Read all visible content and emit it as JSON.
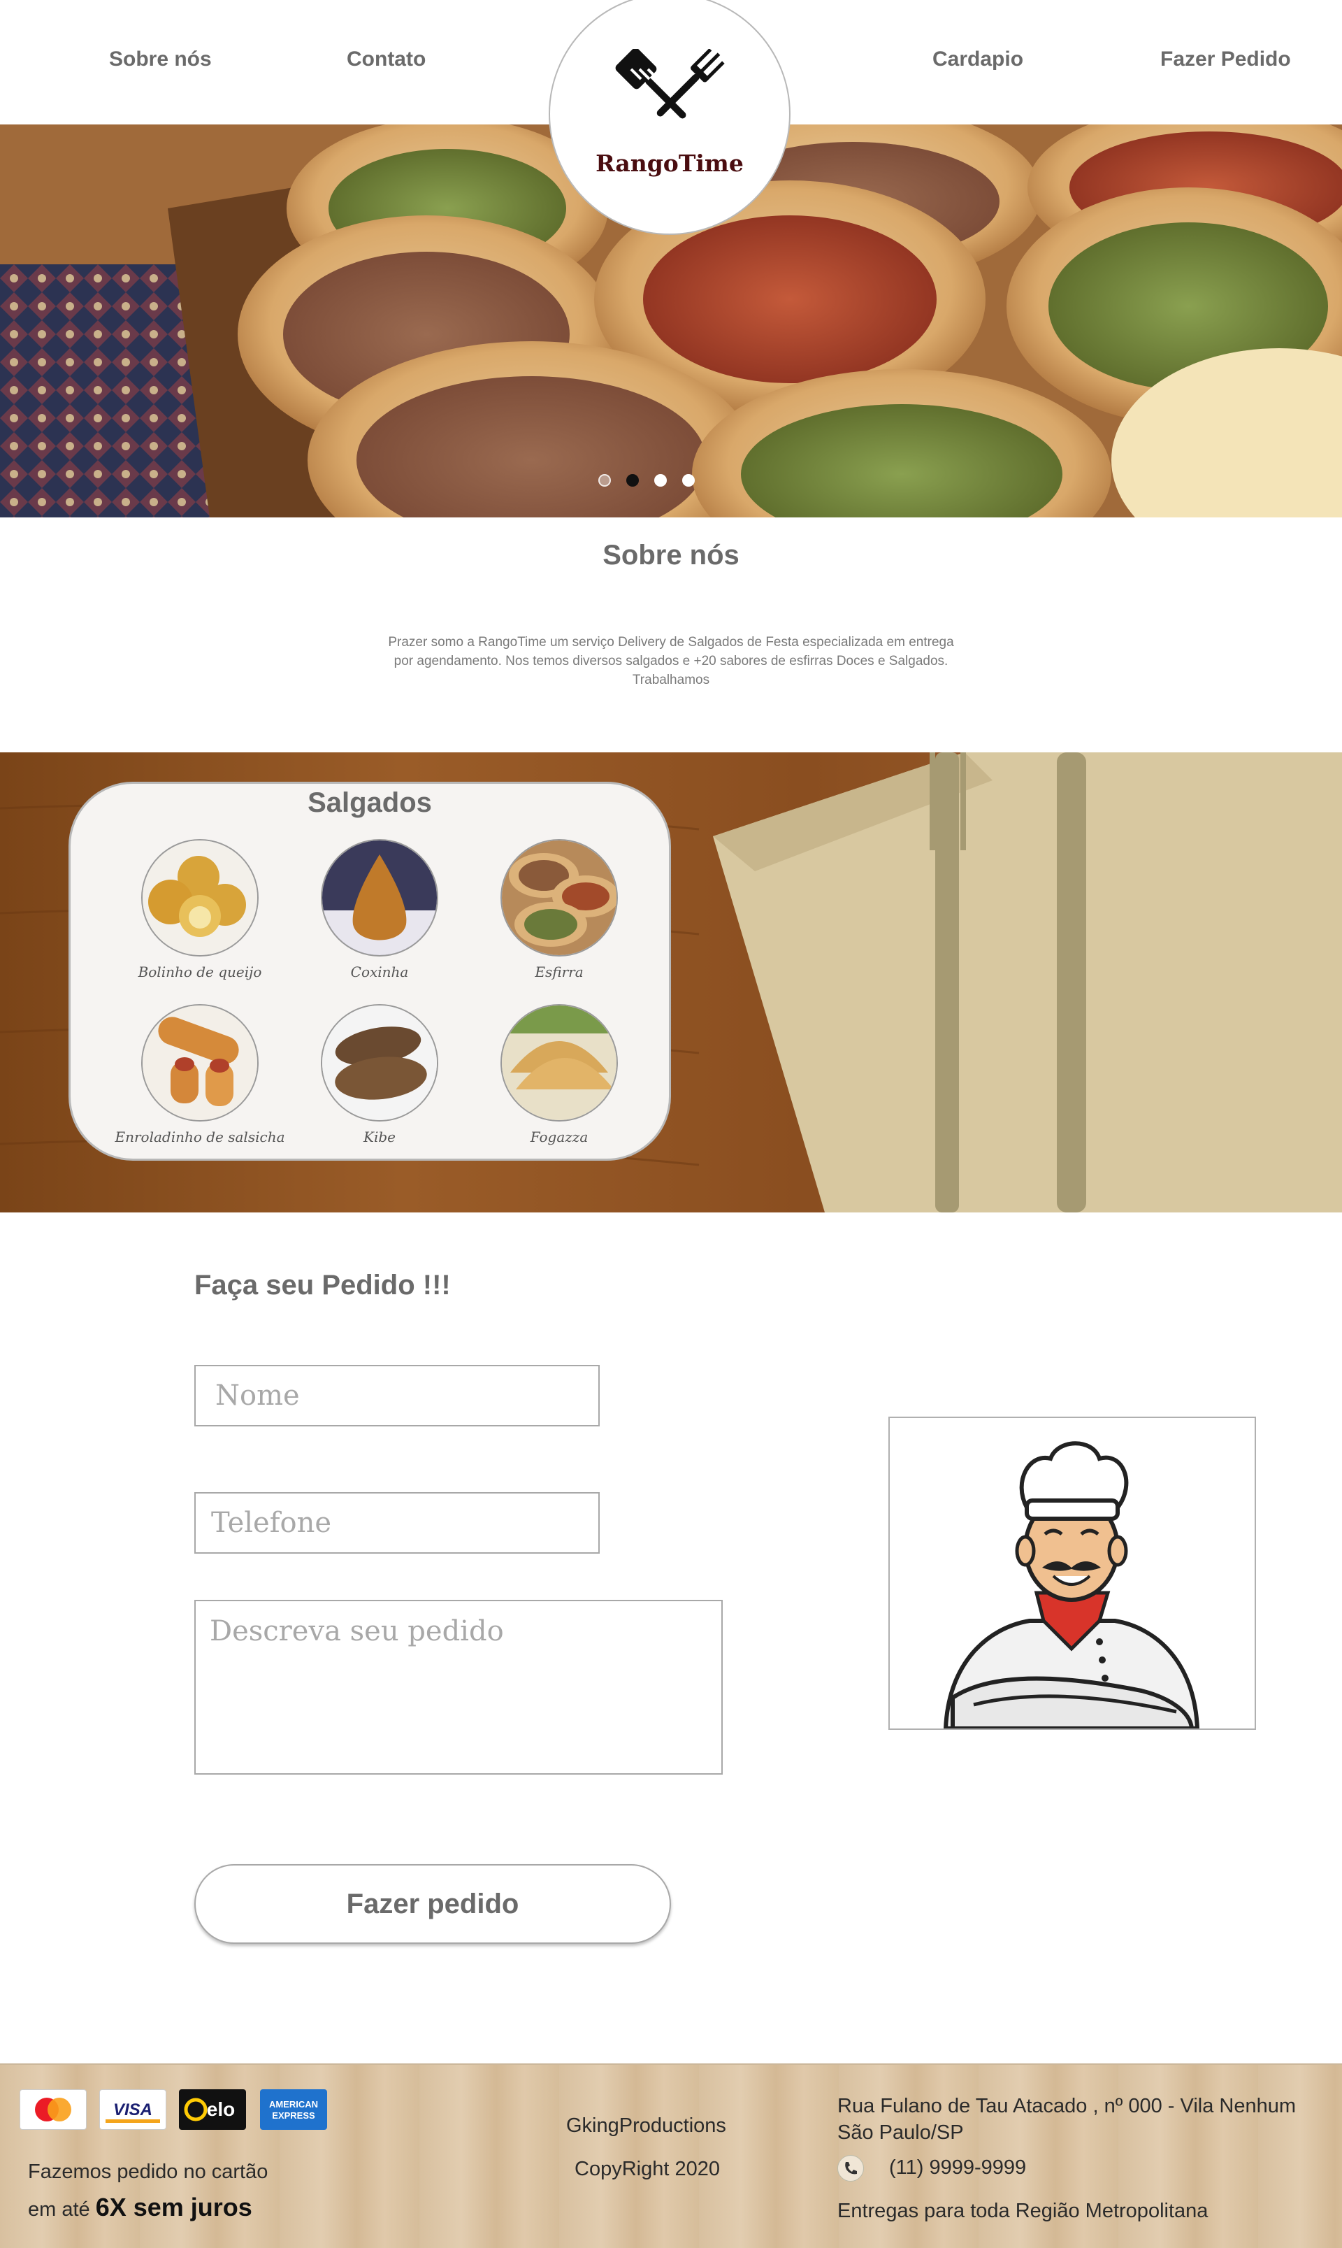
{
  "nav": {
    "items": [
      "Sobre nós",
      "Contato",
      "Cardapio",
      "Fazer Pedido"
    ],
    "logo_text": "RangoTime"
  },
  "hero": {
    "slides": 4,
    "active_slide": 2
  },
  "about": {
    "title": "Sobre nós",
    "lines": [
      "Prazer somo a RangoTime um serviço Delivery de Salgados de Festa especializada em entrega",
      "por agendamento. Nos temos diversos salgados e +20 sabores de esfirras Doces e Salgados.",
      "Trabalhamos"
    ]
  },
  "salgados": {
    "title": "Salgados",
    "items": [
      "Bolinho de queijo",
      "Coxinha",
      "Esfirra",
      "Enroladinho de salsicha",
      "Kibe",
      "Fogazza"
    ]
  },
  "order": {
    "title": "Faça seu Pedido !!!",
    "name_placeholder": "Nome",
    "phone_placeholder": "Telefone",
    "description_placeholder": "Descreva seu pedido",
    "submit_label": "Fazer pedido"
  },
  "footer": {
    "card_logos": [
      "mastercard-icon",
      "visa-icon",
      "elo-icon",
      "amex-icon"
    ],
    "visa_text": "VISA",
    "elo_text": "elo",
    "amex_line1": "AMERICAN",
    "amex_line2": "EXPRESS",
    "installments_line1": "Fazemos pedido no cartão",
    "installments_prefix": "em até ",
    "installments_bold": "6X sem juros",
    "company": "GkingProductions",
    "copyright": "CopyRight 2020",
    "address_line1": "Rua Fulano de Tau Atacado , nº 000 - Vila Nenhum",
    "address_line2": "São Paulo/SP",
    "phone": "(11) 9999-9999",
    "delivery": "Entregas para toda Região Metropolitana"
  },
  "colors": {
    "logo_text": "#4a0d10",
    "heading": "#6a6a6a"
  }
}
